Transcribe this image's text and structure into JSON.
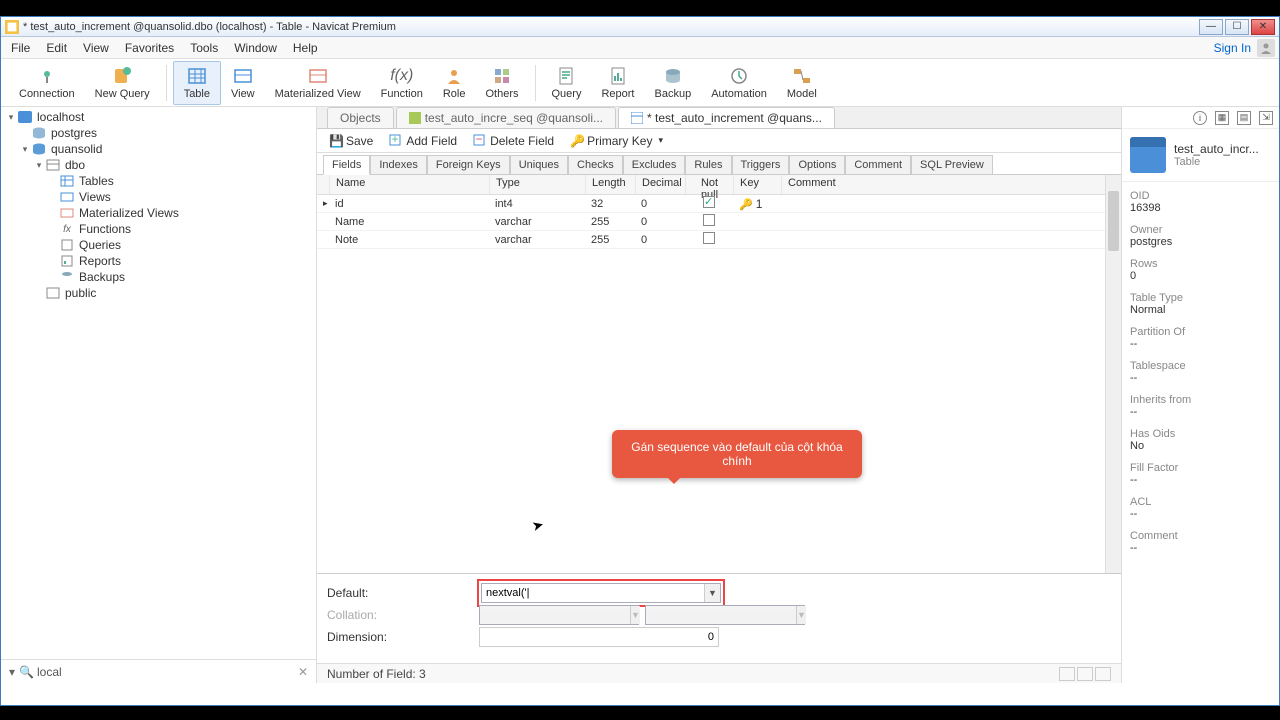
{
  "window": {
    "title": "* test_auto_increment @quansolid.dbo (localhost) - Table - Navicat Premium"
  },
  "menubar": {
    "items": [
      "File",
      "Edit",
      "View",
      "Favorites",
      "Tools",
      "Window",
      "Help"
    ],
    "signin": "Sign In"
  },
  "toolbar": {
    "connection": "Connection",
    "new_query": "New Query",
    "table": "Table",
    "view": "View",
    "mview": "Materialized View",
    "function": "Function",
    "role": "Role",
    "others": "Others",
    "query": "Query",
    "report": "Report",
    "backup": "Backup",
    "automation": "Automation",
    "model": "Model"
  },
  "tree": {
    "localhost": "localhost",
    "postgres": "postgres",
    "quansolid": "quansolid",
    "dbo": "dbo",
    "tables": "Tables",
    "views": "Views",
    "mviews": "Materialized Views",
    "functions": "Functions",
    "queries": "Queries",
    "reports": "Reports",
    "backups": "Backups",
    "public": "public"
  },
  "search": {
    "value": "local"
  },
  "obj_tabs": {
    "objects": "Objects",
    "seq_tab": "test_auto_incre_seq @quansoli...",
    "table_tab": "* test_auto_increment @quans..."
  },
  "action_bar": {
    "save": "Save",
    "add_field": "Add Field",
    "delete_field": "Delete Field",
    "primary_key": "Primary Key"
  },
  "sub_tabs": [
    "Fields",
    "Indexes",
    "Foreign Keys",
    "Uniques",
    "Checks",
    "Excludes",
    "Rules",
    "Triggers",
    "Options",
    "Comment",
    "SQL Preview"
  ],
  "grid": {
    "headers": {
      "name": "Name",
      "type": "Type",
      "length": "Length",
      "decimal": "Decimal",
      "notnull": "Not null",
      "key": "Key",
      "comment": "Comment"
    },
    "rows": [
      {
        "name": "id",
        "type": "int4",
        "length": "32",
        "decimal": "0",
        "notnull": true,
        "key": "1"
      },
      {
        "name": "Name",
        "type": "varchar",
        "length": "255",
        "decimal": "0",
        "notnull": false,
        "key": ""
      },
      {
        "name": "Note",
        "type": "varchar",
        "length": "255",
        "decimal": "0",
        "notnull": false,
        "key": ""
      }
    ]
  },
  "field_props": {
    "default_label": "Default:",
    "default_value": "nextval('|",
    "collation_label": "Collation:",
    "dimension_label": "Dimension:",
    "dimension_value": "0"
  },
  "status": {
    "fields": "Number of Field: 3"
  },
  "info": {
    "title": "test_auto_incr...",
    "subtitle": "Table",
    "oid_label": "OID",
    "oid_value": "16398",
    "owner_label": "Owner",
    "owner_value": "postgres",
    "rows_label": "Rows",
    "rows_value": "0",
    "tabletype_label": "Table Type",
    "tabletype_value": "Normal",
    "partof_label": "Partition Of",
    "partof_value": "--",
    "tablespace_label": "Tablespace",
    "tablespace_value": "--",
    "inherits_label": "Inherits from",
    "inherits_value": "--",
    "hasoids_label": "Has Oids",
    "hasoids_value": "No",
    "fillfactor_label": "Fill Factor",
    "fillfactor_value": "--",
    "acl_label": "ACL",
    "acl_value": "--",
    "comment_label": "Comment",
    "comment_value": "--"
  },
  "callout": {
    "text": "Gán sequence vào default của cột khóa chính"
  }
}
